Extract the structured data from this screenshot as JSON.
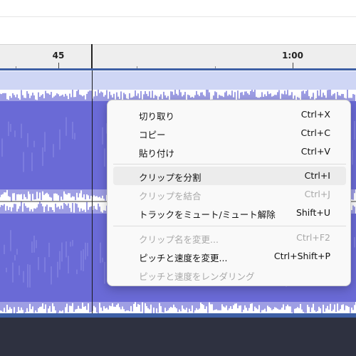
{
  "timeline": {
    "labels": [
      "45",
      "1:00"
    ]
  },
  "colors": {
    "waveform": "#6a6ad6",
    "clip_header": "#cfd6f5",
    "track_border": "#3d5fa5"
  },
  "context_menu": {
    "items": [
      {
        "label": "切り取り",
        "shortcut": "Ctrl+X",
        "enabled": true
      },
      {
        "label": "コピー",
        "shortcut": "Ctrl+C",
        "enabled": true
      },
      {
        "label": "貼り付け",
        "shortcut": "Ctrl+V",
        "enabled": true
      },
      {
        "label": "クリップを分割",
        "shortcut": "Ctrl+I",
        "enabled": true,
        "highlighted": true
      },
      {
        "label": "クリップを結合",
        "shortcut": "Ctrl+J",
        "enabled": false
      },
      {
        "label": "トラックをミュート/ミュート解除",
        "shortcut": "Shift+U",
        "enabled": true
      },
      {
        "label": "クリップ名を変更...",
        "shortcut": "Ctrl+F2",
        "enabled": false
      },
      {
        "label": "ピッチと速度を変更...",
        "shortcut": "Ctrl+Shift+P",
        "enabled": true
      },
      {
        "label": "ピッチと速度をレンダリング",
        "shortcut": "",
        "enabled": false
      }
    ]
  }
}
